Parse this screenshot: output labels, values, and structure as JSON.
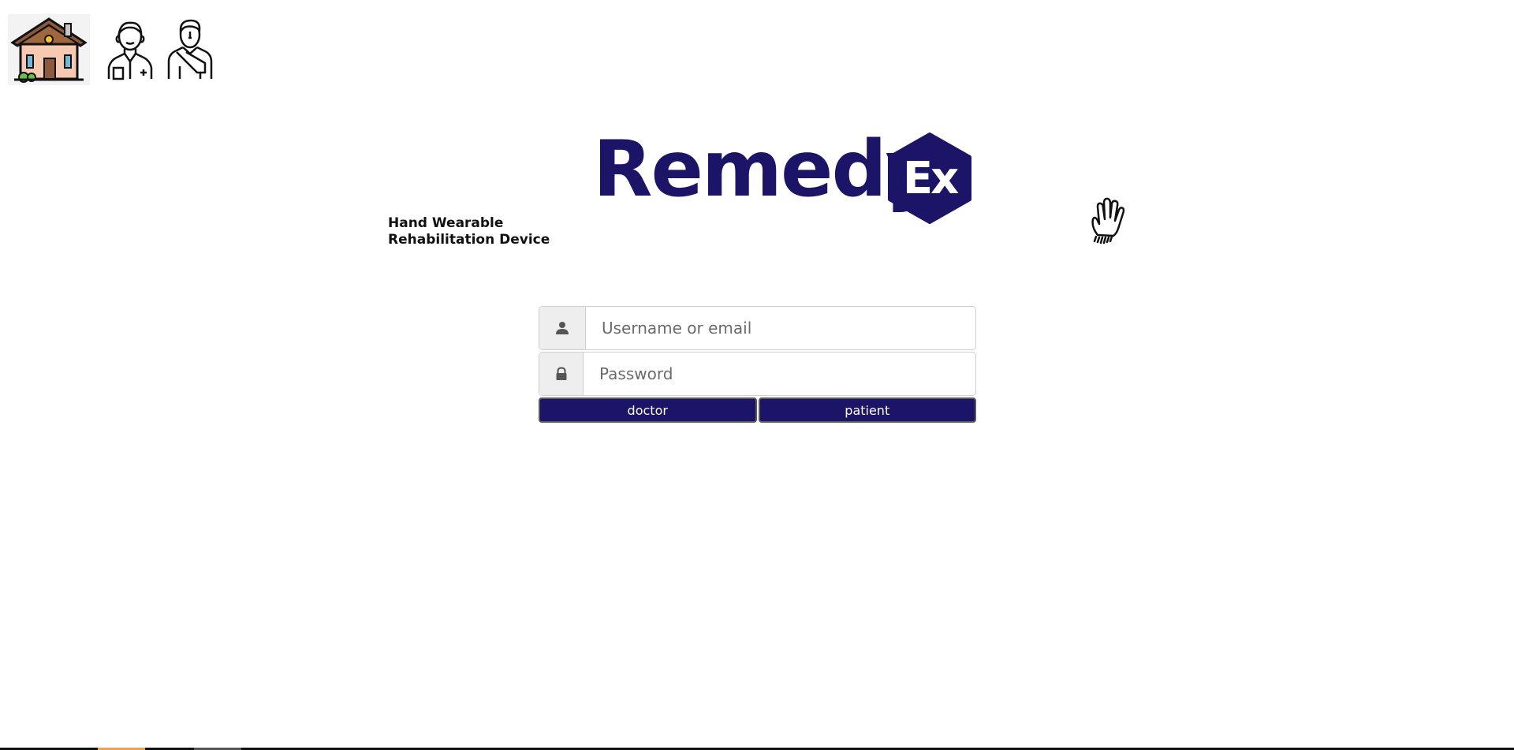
{
  "nav": {
    "home_icon": "house-icon",
    "doctor_icon": "doctor-icon",
    "patient_icon": "patient-icon"
  },
  "brand": {
    "name": "Remedy",
    "badge": "Ex",
    "color": "#1c1466"
  },
  "tagline": {
    "line1": "Hand Wearable",
    "line2": "Rehabilitation Device"
  },
  "decor": {
    "hand_icon": "hand-icon"
  },
  "login": {
    "username_placeholder": "Username or email",
    "username_value": "",
    "password_placeholder": "Password",
    "password_value": "",
    "user_icon": "user-icon",
    "lock_icon": "lock-icon"
  },
  "buttons": {
    "doctor_label": "doctor",
    "patient_label": "patient",
    "color": "#1c1466"
  }
}
